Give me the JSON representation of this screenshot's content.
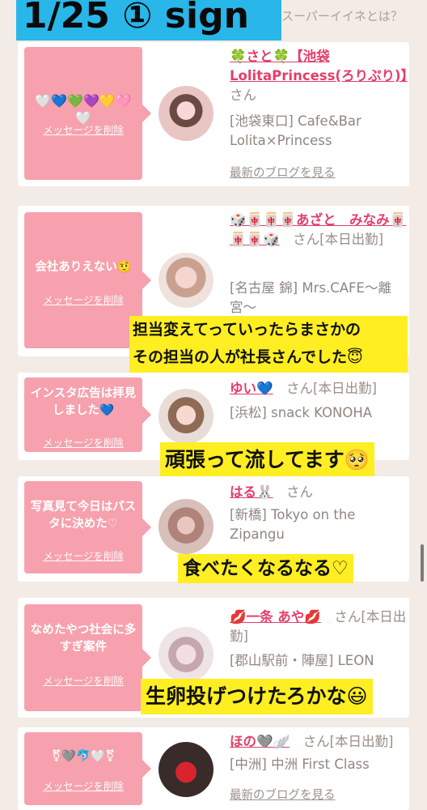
{
  "header": {
    "title": "1/25 ① sign",
    "link": "スーパーイイネとは？"
  },
  "cards": [
    {
      "msg": "",
      "msg_icons": "🤍💙💚💜💛🩷🤍",
      "delete": "メッセージを削除",
      "name": "🍀さと🍀【池袋LolitaPrincess(ろりぷり)】",
      "san": "さん",
      "shop": "[池袋東口] Cafe&Bar Lolita×Princess",
      "blog": "最新のブログを見る"
    },
    {
      "msg": "会社ありえない🤨",
      "delete": "メッセージを削除",
      "name": "🎲🀄🀄🀄あざと　みなみ🀄🀄🀄🎲",
      "san": "さん[本日出勤]",
      "shop": "[名古屋 錦] Mrs.CAFE〜離宮〜",
      "overlay": [
        "担当変えてっていったらまさかの",
        "その担当の人が社長さんでした😇"
      ]
    },
    {
      "msg": "インスタ広告は拝見しました💙",
      "delete": "メッセージを削除",
      "name": "ゆい💙",
      "san": "さん[本日出勤]",
      "shop": "[浜松] snack KONOHA",
      "overlay": "頑張って流してます🥺"
    },
    {
      "msg": "写真見て今日はパスタに決めた♡",
      "delete": "メッセージを削除",
      "name": "はる🐰",
      "san": "さん",
      "shop": "[新橋] Tokyo on the Zipangu",
      "overlay": "食べたくなるなる♡"
    },
    {
      "msg": "なめたやつ社会に多すぎ案件",
      "delete": "メッセージを削除",
      "name": "💋一条 あや💋",
      "san": "さん[本日出勤]",
      "shop": "[郡山駅前・陣屋] LEON",
      "overlay": "生卵投げつけたろかな😃"
    },
    {
      "msg": "",
      "msg_icons": "⚧🩶🐬🤍⚧",
      "delete": "メッセージを削除",
      "name": "ほの🩶🪽",
      "san": "さん[本日出勤]",
      "shop": "[中洲] 中洲 First Class",
      "blog": "最新のブログを見る"
    }
  ]
}
